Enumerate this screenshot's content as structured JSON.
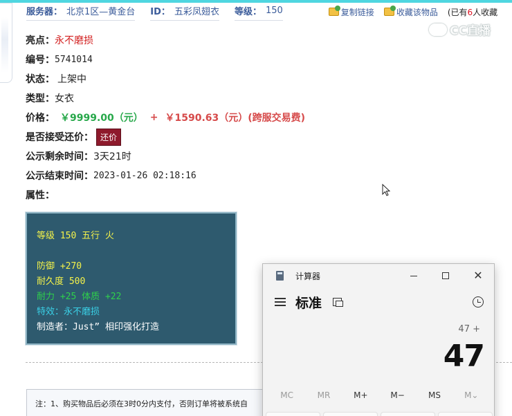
{
  "header": {
    "server_label": "服务器：",
    "server_value": "北京1区—黄金台",
    "id_label": "ID：",
    "id_value": "五彩凤翅衣",
    "level_label": "等级：",
    "level_value": "150",
    "copy_link": "复制链接",
    "favorite": "收藏该物品",
    "count_prefix": "(已有",
    "count_num": "6",
    "count_suffix": "人收藏"
  },
  "watermark": "CC直播",
  "details": {
    "highlight_label": "亮点：",
    "highlight_value": "永不磨损",
    "id_label": "编号：",
    "id_value": "5741014",
    "status_label": "状态：",
    "status_value": "上架中",
    "type_label": "类型：",
    "type_value": "女衣",
    "price_label": "价格：",
    "price_main": "￥9999.00（元）",
    "price_plus": "+",
    "price_fee": "￥1590.63（元）(跨服交易费)",
    "counter_label": "是否接受还价：",
    "counter_button": "还价",
    "remaining_label": "公示剩余时间：",
    "remaining_value": "3天21时",
    "end_label": "公示结束时间：",
    "end_value": "2023-01-26 02:18:16",
    "attr_label": "属性："
  },
  "attributes": {
    "line1": "等级 150 五行 火",
    "line2": "防御 +270",
    "line3": "耐久度 500",
    "line4": "耐力 +25 体质 +22",
    "line5": "特效：永不磨损",
    "line6": "制造者：Just” 相印强化打造"
  },
  "notice": "注：1、购买物品后必须在3时0分内支付，否则订单将被系统自",
  "calculator": {
    "title": "计算器",
    "mode": "标准",
    "expression": "47 +",
    "display": "47",
    "memory": [
      "MC",
      "MR",
      "M+",
      "M−",
      "MS",
      "M⌄"
    ]
  }
}
